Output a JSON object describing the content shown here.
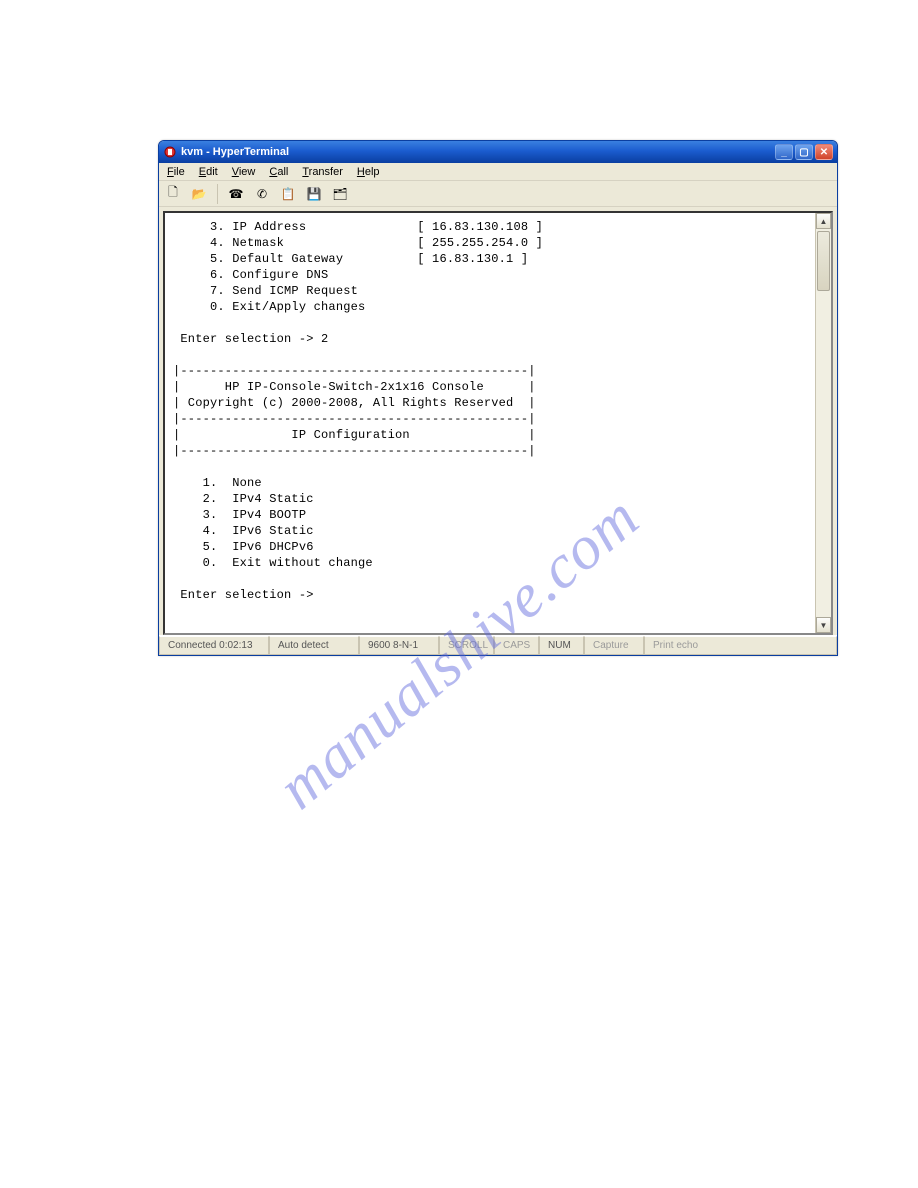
{
  "watermark": "manualshive.com",
  "window": {
    "title": "kvm - HyperTerminal",
    "buttons": {
      "min": "_",
      "max": "▢",
      "close": "✕"
    }
  },
  "menubar": {
    "file": "File",
    "edit": "Edit",
    "view": "View",
    "call": "Call",
    "transfer": "Transfer",
    "help": "Help"
  },
  "toolbar": {
    "new": "🗋",
    "open": "📂",
    "connect": "☎",
    "disconnect": "✆",
    "send": "📋",
    "receive": "💾",
    "properties": "🗂"
  },
  "terminal_lines": [
    "     3. IP Address               [ 16.83.130.108 ]",
    "     4. Netmask                  [ 255.255.254.0 ]",
    "     5. Default Gateway          [ 16.83.130.1 ]",
    "     6. Configure DNS",
    "     7. Send ICMP Request",
    "     0. Exit/Apply changes",
    "",
    " Enter selection -> 2",
    "",
    "|-----------------------------------------------|",
    "|      HP IP-Console-Switch-2x1x16 Console      |",
    "| Copyright (c) 2000-2008, All Rights Reserved  |",
    "|-----------------------------------------------|",
    "|               IP Configuration                |",
    "|-----------------------------------------------|",
    "",
    "    1.  None",
    "    2.  IPv4 Static",
    "    3.  IPv4 BOOTP",
    "    4.  IPv6 Static",
    "    5.  IPv6 DHCPv6",
    "    0.  Exit without change",
    "",
    " Enter selection ->"
  ],
  "statusbar": {
    "connected": "Connected 0:02:13",
    "autodetect": "Auto detect",
    "settings": "9600 8-N-1",
    "scroll": "SCROLL",
    "caps": "CAPS",
    "num": "NUM",
    "capture": "Capture",
    "printecho": "Print echo"
  },
  "network_menu": {
    "items": [
      {
        "num": "3",
        "label": "IP Address",
        "value": "16.83.130.108"
      },
      {
        "num": "4",
        "label": "Netmask",
        "value": "255.255.254.0"
      },
      {
        "num": "5",
        "label": "Default Gateway",
        "value": "16.83.130.1"
      },
      {
        "num": "6",
        "label": "Configure DNS"
      },
      {
        "num": "7",
        "label": "Send ICMP Request"
      },
      {
        "num": "0",
        "label": "Exit/Apply changes"
      }
    ],
    "prompt": "Enter selection ->",
    "entered": "2"
  },
  "banner": {
    "line1": "HP IP-Console-Switch-2x1x16 Console",
    "line2": "Copyright (c) 2000-2008, All Rights Reserved",
    "section": "IP Configuration"
  },
  "ipconfig_menu": {
    "items": [
      {
        "num": "1",
        "label": "None"
      },
      {
        "num": "2",
        "label": "IPv4 Static"
      },
      {
        "num": "3",
        "label": "IPv4 BOOTP"
      },
      {
        "num": "4",
        "label": "IPv6 Static"
      },
      {
        "num": "5",
        "label": "IPv6 DHCPv6"
      },
      {
        "num": "0",
        "label": "Exit without change"
      }
    ],
    "prompt": "Enter selection ->"
  }
}
